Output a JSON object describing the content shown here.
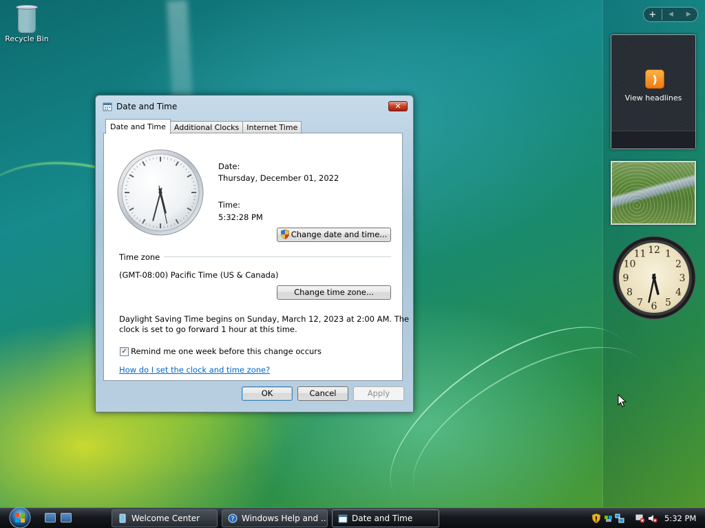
{
  "desktop": {
    "recycle_bin_label": "Recycle Bin"
  },
  "sidebar": {
    "controls": {
      "add": "+",
      "prev": "◀",
      "next": "▶"
    },
    "feed_gadget": {
      "label": "View headlines"
    },
    "clock_gadget": {
      "numerals": [
        "12",
        "1",
        "2",
        "3",
        "4",
        "5",
        "6",
        "7",
        "8",
        "9",
        "10",
        "11"
      ],
      "time": "5:32"
    }
  },
  "dialog": {
    "title": "Date and Time",
    "close_glyph": "✕",
    "tabs": [
      {
        "label": "Date and Time",
        "active": true
      },
      {
        "label": "Additional Clocks",
        "active": false
      },
      {
        "label": "Internet Time",
        "active": false
      }
    ],
    "date_label": "Date:",
    "date_value": "Thursday, December 01, 2022",
    "time_label": "Time:",
    "time_value": "5:32:28 PM",
    "change_datetime_button": "Change date and time...",
    "timezone_heading": "Time zone",
    "timezone_value": "(GMT-08:00) Pacific Time (US & Canada)",
    "change_timezone_button": "Change time zone...",
    "dst_line1": "Daylight Saving Time begins on Sunday, March 12, 2023 at 2:00 AM. The",
    "dst_line2": "clock is set to go forward 1 hour at this time.",
    "remind_label": "Remind me one week before this change occurs",
    "remind_checked": true,
    "check_glyph": "✓",
    "help_link": "How do I set the clock and time zone?",
    "ok_button": "OK",
    "cancel_button": "Cancel",
    "apply_button": "Apply",
    "clock": {
      "hour": 5,
      "minute": 32,
      "second": 28
    }
  },
  "taskbar": {
    "tasks": [
      {
        "label": "Welcome Center",
        "active": false
      },
      {
        "label": "Windows Help and ...",
        "active": false
      },
      {
        "label": "Date and Time",
        "active": true
      }
    ],
    "clock": "5:32 PM"
  },
  "colors": {
    "accent": "#3c7fb1",
    "link": "#0066cc",
    "close_button": "#c6402a",
    "rss": "#f07a10"
  }
}
